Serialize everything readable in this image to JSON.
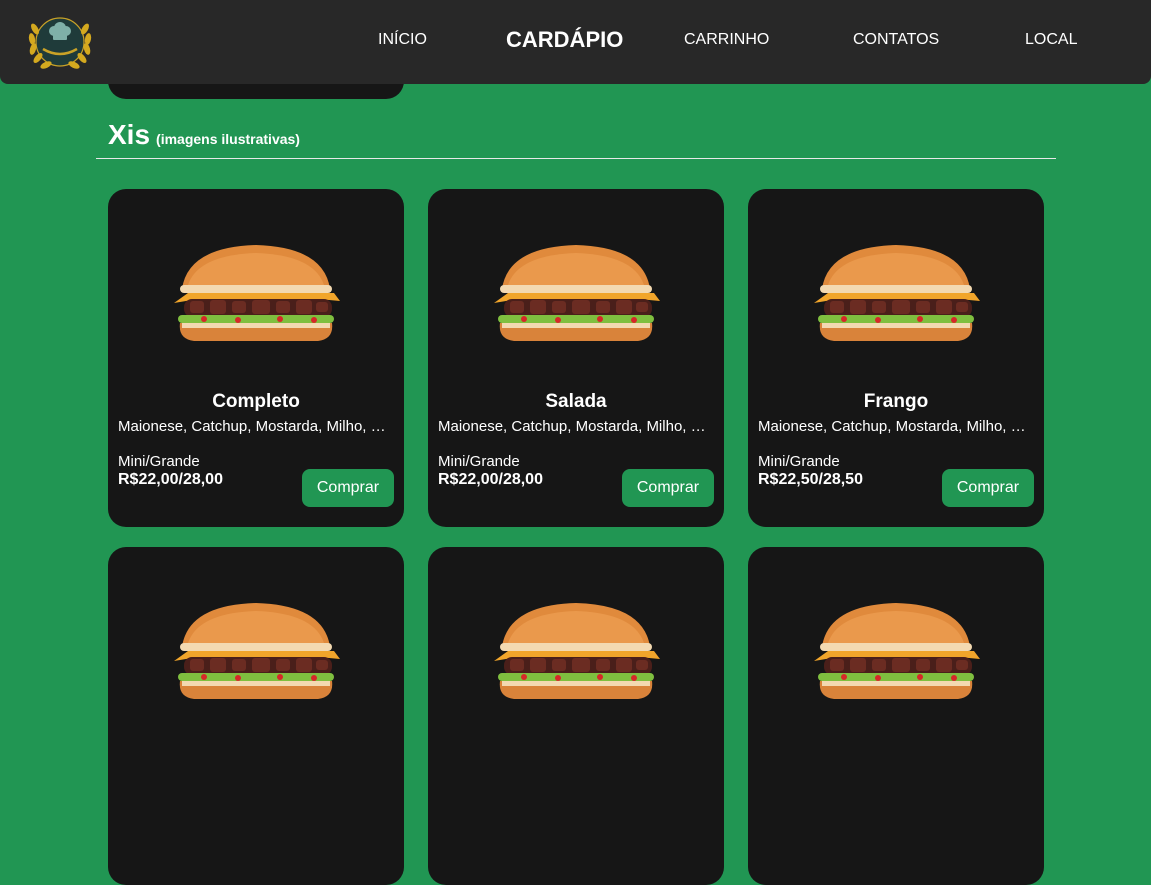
{
  "nav": {
    "items": [
      {
        "label": "INÍCIO",
        "active": false
      },
      {
        "label": "CARDÁPIO",
        "active": true
      },
      {
        "label": "CARRINHO",
        "active": false
      },
      {
        "label": "CONTATOS",
        "active": false
      },
      {
        "label": "LOCAL",
        "active": false
      }
    ],
    "logo_icon": "chef-laurel-logo-icon"
  },
  "section": {
    "title": "Xis",
    "subtitle": "(imagens ilustrativas)"
  },
  "products": [
    {
      "name": "Completo",
      "description": "Maionese, Catchup, Mostarda, Milho, Ervilha, Alface, Tomate",
      "size_label": "Mini/Grande",
      "price": "R$22,00/28,00",
      "button": "Comprar"
    },
    {
      "name": "Salada",
      "description": "Maionese, Catchup, Mostarda, Milho, Ervilha, Alface, Tomate",
      "size_label": "Mini/Grande",
      "price": "R$22,00/28,00",
      "button": "Comprar"
    },
    {
      "name": "Frango",
      "description": "Maionese, Catchup, Mostarda, Milho, Ervilha, Alface, Tomate",
      "size_label": "Mini/Grande",
      "price": "R$22,50/28,50",
      "button": "Comprar"
    },
    {
      "name": "",
      "description": "",
      "size_label": "",
      "price": "",
      "button": ""
    },
    {
      "name": "",
      "description": "",
      "size_label": "",
      "price": "",
      "button": ""
    },
    {
      "name": "",
      "description": "",
      "size_label": "",
      "price": "",
      "button": ""
    }
  ],
  "colors": {
    "background": "#219653",
    "navbar": "#282828",
    "card": "#161616",
    "button": "#219653"
  }
}
